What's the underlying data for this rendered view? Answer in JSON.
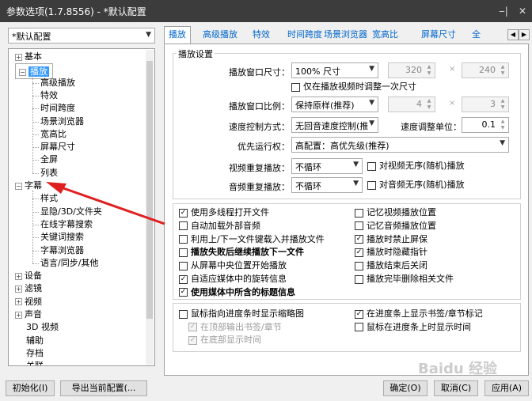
{
  "window": {
    "title": "参数选项(1.7.8556) - *默认配置",
    "pin": "‒|",
    "close": "✕"
  },
  "profile": {
    "value": "*默认配置"
  },
  "tree": [
    {
      "label": "基本",
      "exp": "+"
    },
    {
      "label": "播放",
      "exp": "−"
    },
    {
      "label": "高级播放"
    },
    {
      "label": "特效"
    },
    {
      "label": "时间跨度"
    },
    {
      "label": "场景浏览器"
    },
    {
      "label": "宽高比"
    },
    {
      "label": "屏幕尺寸"
    },
    {
      "label": "全屏"
    },
    {
      "label": "列表"
    },
    {
      "label": "字幕",
      "exp": "−"
    },
    {
      "label": "样式"
    },
    {
      "label": "显隐/3D/文件夹"
    },
    {
      "label": "在线字幕搜索"
    },
    {
      "label": "关键词搜索"
    },
    {
      "label": "字幕浏览器"
    },
    {
      "label": "语言/同步/其他"
    },
    {
      "label": "设备",
      "exp": "+"
    },
    {
      "label": "滤镜",
      "exp": "+"
    },
    {
      "label": "视频",
      "exp": "+"
    },
    {
      "label": "声音",
      "exp": "+"
    },
    {
      "label": "3D 视频"
    },
    {
      "label": "辅助"
    },
    {
      "label": "存档"
    },
    {
      "label": "关联"
    }
  ],
  "tabs": [
    "播放",
    "高级播放",
    "特效",
    "时间跨度",
    "场景浏览器",
    "宽高比",
    "屏幕尺寸",
    "全"
  ],
  "tab_nav": {
    "prev": "◀",
    "next": "▶"
  },
  "playback": {
    "group_label": "播放设置",
    "window_size_label": "播放窗口尺寸：",
    "window_size_value": "100% 尺寸",
    "width": "320",
    "height": "240",
    "times": "×",
    "resize_once": "仅在播放视频时调整一次尺寸",
    "ratio_label": "播放窗口比例：",
    "ratio_value": "保持原样(推荐)",
    "ratio_w": "4",
    "ratio_h": "3",
    "speed_label": "速度控制方式：",
    "speed_value": "无回音速度控制(推",
    "speed_unit_label": "速度调整单位：",
    "speed_unit_value": "0.1",
    "priority_label": "优先运行权：",
    "priority_value": "高配置：高优先级(推荐)",
    "video_repeat_label": "视频重复播放：",
    "video_repeat_value": "不循环",
    "video_random": "对视频无序(随机)播放",
    "audio_repeat_label": "音频重复播放：",
    "audio_repeat_value": "不循环",
    "audio_random": "对音频无序(随机)播放"
  },
  "options_left": [
    {
      "label": "使用多线程打开文件",
      "checked": true
    },
    {
      "label": "自动加载外部音频",
      "checked": false
    },
    {
      "label": "利用上/下一文件键载入并播放文件",
      "checked": false
    },
    {
      "label": "播放失败后继续播放下一文件",
      "checked": false,
      "bold": true
    },
    {
      "label": "从屏幕中央位置开始播放",
      "checked": false
    },
    {
      "label": "自适应媒体中的旋转信息",
      "checked": true
    },
    {
      "label": "使用媒体中所含的标题信息",
      "checked": true,
      "bold": true
    }
  ],
  "options_right": [
    {
      "label": "记忆视频播放位置",
      "checked": false
    },
    {
      "label": "记忆音频播放位置",
      "checked": false
    },
    {
      "label": "播放时禁止屏保",
      "checked": true
    },
    {
      "label": "播放时隐藏指针",
      "checked": true
    },
    {
      "label": "播放结束后关闭",
      "checked": false
    },
    {
      "label": "播放完毕删除相关文件",
      "checked": false
    }
  ],
  "seek_left": [
    {
      "label": "鼠标指向进度条时显示缩略图",
      "checked": false
    },
    {
      "label": "在顶部输出书签/章节",
      "checked": true,
      "disabled": true
    },
    {
      "label": "在底部显示时间",
      "checked": true,
      "disabled": true
    }
  ],
  "seek_right": [
    {
      "label": "在进度条上显示书签/章节标记",
      "checked": true
    },
    {
      "label": "鼠标在进度条上时显示时间",
      "checked": false
    }
  ],
  "buttons": {
    "init": "初始化(I)",
    "export": "导出当前配置(...",
    "ok": "确定(O)",
    "cancel": "取消(C)",
    "apply": "应用(A)"
  },
  "watermark": "Baidu 经验",
  "colors": {
    "titlebar": "#3c3c3c",
    "selection": "#3399ff",
    "tab_text": "#0066cc",
    "annotation_arrow": "#e02020"
  }
}
